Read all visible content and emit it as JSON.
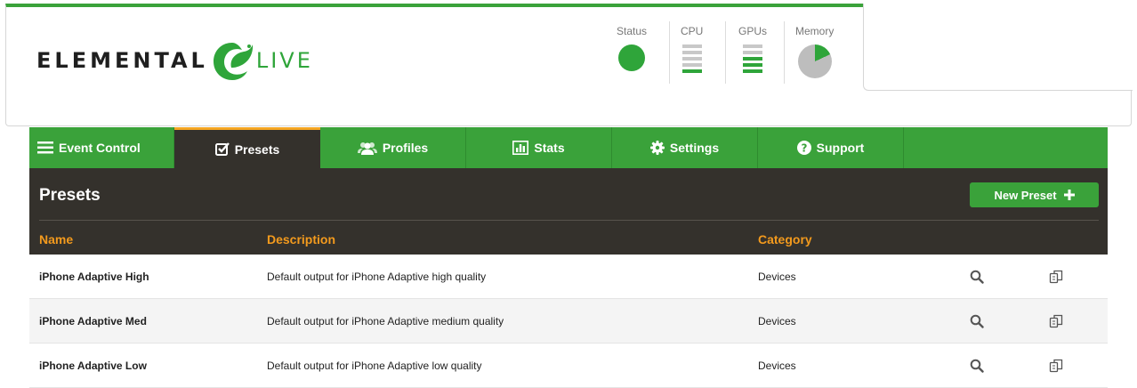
{
  "header": {
    "logo": {
      "left": "ELEMENTAL",
      "right": "LIVE"
    },
    "stats": {
      "status_label": "Status",
      "cpu_label": "CPU",
      "gpus_label": "GPUs",
      "memory_label": "Memory",
      "status_color": "#2fa53a",
      "cpu_level_bars": 1,
      "gpu_level_bars": 3,
      "memory_used_fraction": 0.18
    }
  },
  "tabs": [
    {
      "label": "Event Control",
      "icon": "list-icon"
    },
    {
      "label": "Presets",
      "icon": "checkbox-icon",
      "active": true
    },
    {
      "label": "Profiles",
      "icon": "users-icon"
    },
    {
      "label": "Stats",
      "icon": "bar-chart-icon"
    },
    {
      "label": "Settings",
      "icon": "gear-icon"
    },
    {
      "label": "Support",
      "icon": "question-icon"
    }
  ],
  "main": {
    "title": "Presets",
    "new_button_label": "New Preset",
    "columns": {
      "name": "Name",
      "description": "Description",
      "category": "Category"
    },
    "rows": [
      {
        "name": "iPhone Adaptive High",
        "description": "Default output for iPhone Adaptive high quality",
        "category": "Devices"
      },
      {
        "name": "iPhone Adaptive Med",
        "description": "Default output for iPhone Adaptive medium quality",
        "category": "Devices"
      },
      {
        "name": "iPhone Adaptive Low",
        "description": "Default output for iPhone Adaptive low quality",
        "category": "Devices"
      }
    ]
  },
  "colors": {
    "brand_green": "#3aa23a",
    "accent_orange": "#f39a1d",
    "dark_panel": "#34312c"
  }
}
